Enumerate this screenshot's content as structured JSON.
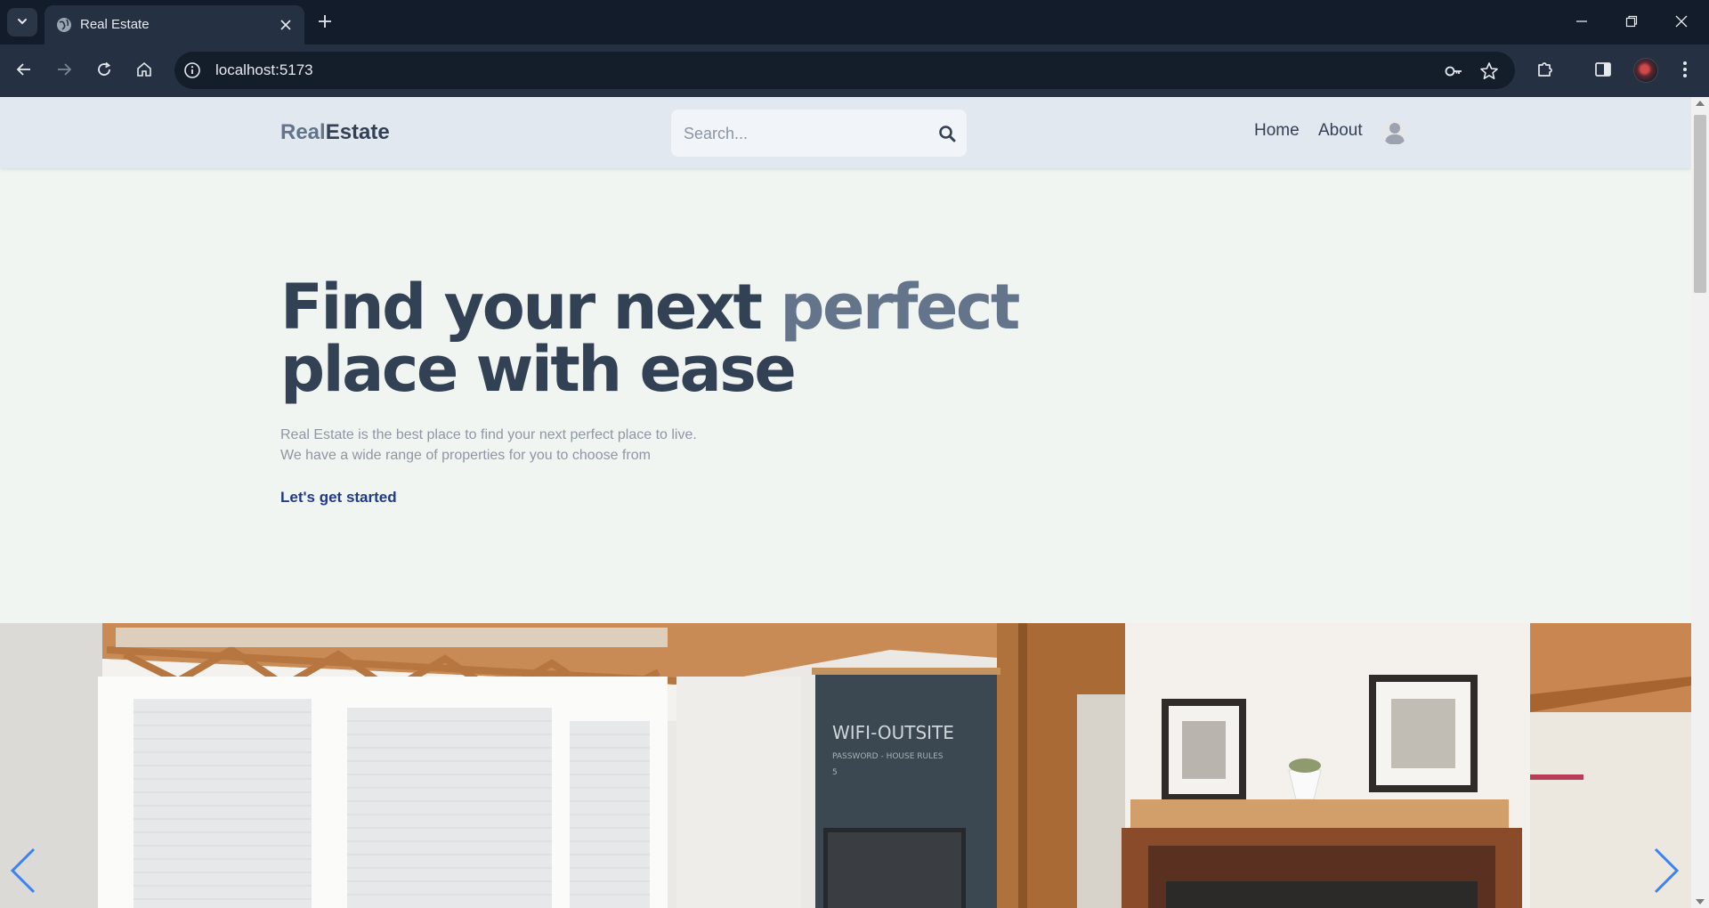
{
  "browser": {
    "tab_title": "Real Estate",
    "url": "localhost:5173"
  },
  "site": {
    "logo_part1": "Real",
    "logo_part2": "Estate",
    "search_placeholder": "Search...",
    "nav": [
      "Home",
      "About"
    ]
  },
  "hero": {
    "title_part1": "Find your next ",
    "title_accent": "perfect",
    "title_part2": "place with ease",
    "subtitle_line1": "Real Estate is the best place to find your next perfect place to live.",
    "subtitle_line2": "We have a wide range of properties for you to choose from",
    "cta": "Let's get started"
  },
  "photo": {
    "chalkboard_line1": "WIFI-OUTSITE",
    "chalkboard_line2": "PASSWORD - HOUSE RULES",
    "chalkboard_line3": "5"
  },
  "colors": {
    "accent_blue": "#1e3a8a",
    "slate_dark": "#334155",
    "slate_light": "#64748b",
    "carousel_arrow": "#3b82f6"
  },
  "icons": {
    "tab_dropdown": "chevron-down-icon",
    "favicon": "globe-icon",
    "close": "close-icon",
    "new_tab": "plus-icon",
    "back": "arrow-left-icon",
    "forward": "arrow-right-icon",
    "reload": "reload-icon",
    "home": "home-icon",
    "site_info": "info-icon",
    "password": "key-icon",
    "bookmark": "star-icon",
    "extensions": "puzzle-icon",
    "sidebar": "sidebar-icon",
    "menu": "kebab-menu-icon",
    "search": "search-icon",
    "profile": "user-avatar-icon",
    "carousel_prev": "chevron-left-icon",
    "carousel_next": "chevron-right-icon"
  }
}
